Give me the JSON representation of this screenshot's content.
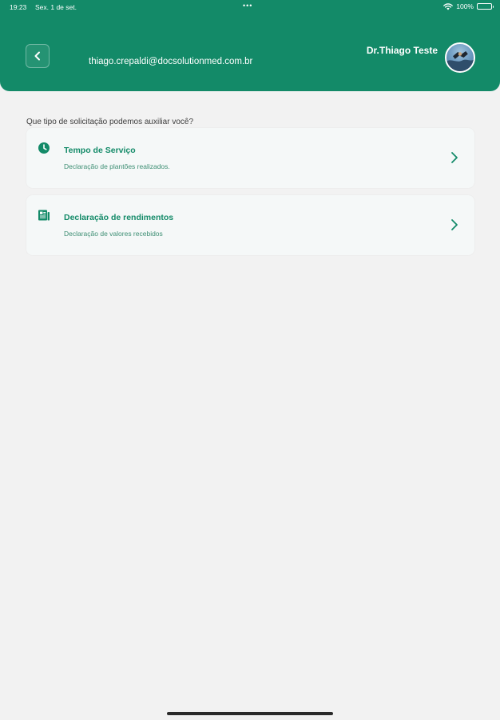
{
  "status_bar": {
    "time": "19:23",
    "date": "Sex. 1 de set.",
    "battery": "100%",
    "multitask_dots": "•••"
  },
  "header": {
    "email": "thiago.crepaldi@docsolutionmed.com.br",
    "user_name": "Dr.Thiago Teste",
    "back_icon": "chevron-left-icon",
    "background_color": "#138a68"
  },
  "main": {
    "question": "Que tipo de solicitação podemos auxiliar você?",
    "cards": [
      {
        "title": "Tempo de Serviço",
        "subtitle": "Declaração de plantões realizados.",
        "icon": "clock-icon"
      },
      {
        "title": "Declaração de rendimentos",
        "subtitle": "Declaração de valores recebidos",
        "icon": "document-icon"
      }
    ]
  },
  "colors": {
    "accent": "#138a68",
    "background": "#f2f2f2",
    "card_background": "#f5f8f8"
  }
}
